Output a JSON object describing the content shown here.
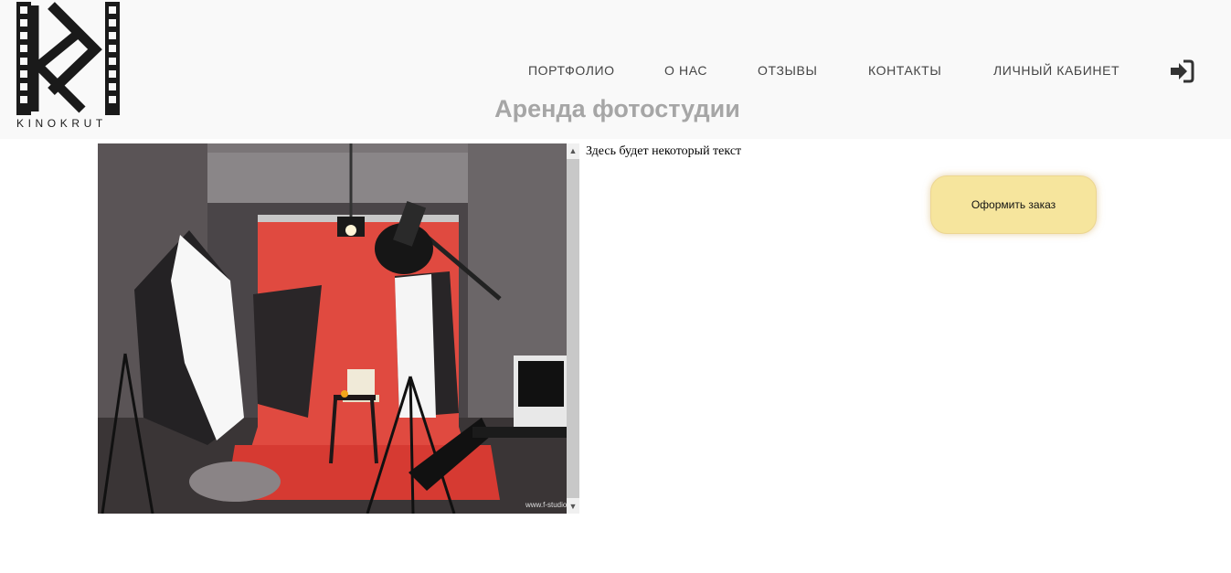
{
  "brand": {
    "name": "KINOKRUT"
  },
  "nav": {
    "items": [
      {
        "label": "ПОРТФОЛИО"
      },
      {
        "label": "О НАС"
      },
      {
        "label": "ОТЗЫВЫ"
      },
      {
        "label": "КОНТАКТЫ"
      },
      {
        "label": "ЛИЧНЫЙ КАБИНЕТ"
      }
    ],
    "login_icon": "sign-in-icon"
  },
  "page": {
    "title": "Аренда фотостудии"
  },
  "content": {
    "description": "Здесь будет некоторый текст",
    "photo_watermark": "www.f-studio",
    "order_button": "Оформить заказ"
  },
  "colors": {
    "header_bg": "#f9f9f9",
    "title_gray": "#a6a6a6",
    "button_bg": "#f6e59d",
    "studio_red": "#e04a40"
  }
}
